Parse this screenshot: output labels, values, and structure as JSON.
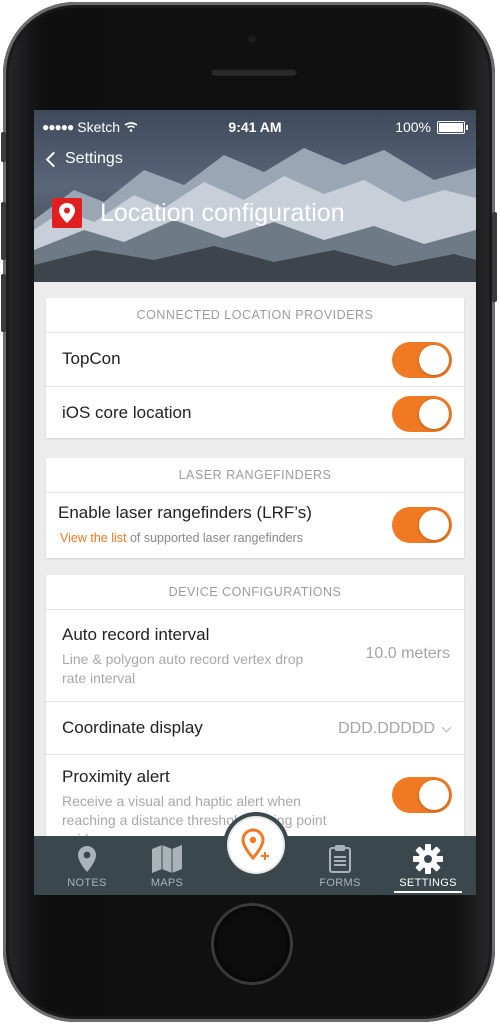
{
  "status_bar": {
    "carrier": "Sketch",
    "time": "9:41 AM",
    "battery": "100%"
  },
  "nav": {
    "back_label": "Settings",
    "title": "Location configuration"
  },
  "connected_providers": {
    "header": "CONNECTED LOCATION PROVIDERS",
    "items": [
      {
        "label": "TopCon",
        "enabled": true
      },
      {
        "label": "iOS core location",
        "enabled": true
      }
    ]
  },
  "laser": {
    "header": "LASER RANGEFINDERS",
    "label": "Enable laser rangefinders (LRF’s)",
    "link_text": "View the list",
    "sub_rest": " of supported laser rangefinders",
    "enabled": true
  },
  "device": {
    "header": "DEVICE CONFIGURATIONS",
    "auto_record": {
      "label": "Auto record interval",
      "sub": "Line & polygon auto record vertex drop rate interval",
      "value": "10.0 meters"
    },
    "coord_display": {
      "label": "Coordinate display",
      "value": "DDD.DDDDD"
    },
    "proximity": {
      "label": "Proximity alert",
      "sub": "Receive a visual and haptic alert when reaching a distance threshold durring point guidance",
      "enabled": true
    }
  },
  "tabbar": {
    "tabs": [
      {
        "label": "NOTES",
        "icon": "map-pin-icon"
      },
      {
        "label": "MAPS",
        "icon": "map-icon"
      },
      {
        "label": "FORMS",
        "icon": "clipboard-icon"
      },
      {
        "label": "SETTINGS",
        "icon": "gear-icon",
        "active": true
      }
    ],
    "fab_icon": "add-location-icon"
  },
  "colors": {
    "accent": "#f07a23",
    "tabbar": "#3a474d",
    "pin_red": "#e02020"
  }
}
